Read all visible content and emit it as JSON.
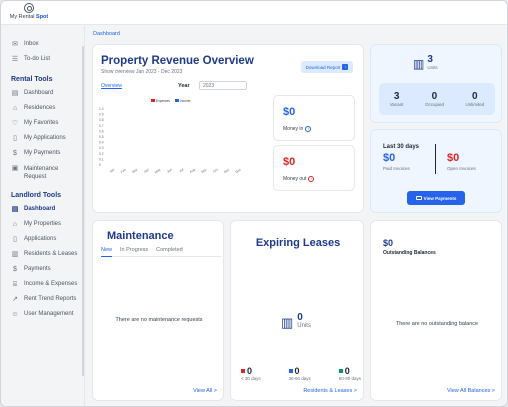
{
  "app": {
    "logo_prefix": "My Rental",
    "logo_brand": "Spot"
  },
  "breadcrumb": "Dashboard",
  "sidebar": {
    "top_items": [
      {
        "label": "Inbox"
      },
      {
        "label": "To-do List"
      }
    ],
    "rental_title": "Rental Tools",
    "rental_items": [
      {
        "label": "Dashboard"
      },
      {
        "label": "Residences"
      },
      {
        "label": "My Favorites"
      },
      {
        "label": "My Applications"
      },
      {
        "label": "My Payments"
      },
      {
        "label": "Maintenance Request"
      }
    ],
    "landlord_title": "Landlord Tools",
    "landlord_items": [
      {
        "label": "Dashboard"
      },
      {
        "label": "My Properties"
      },
      {
        "label": "Applications"
      },
      {
        "label": "Residents & Leases"
      },
      {
        "label": "Payments"
      },
      {
        "label": "Income & Expenses"
      },
      {
        "label": "Rent Trend Reports"
      },
      {
        "label": "User Management"
      }
    ]
  },
  "revenue": {
    "title": "Property Revenue Overview",
    "subtitle": "Show overview Jan 2023 - Dec 2023",
    "tab": "Overview",
    "year_label": "Year",
    "year_value": "2023",
    "download_label": "Download Report",
    "money_in_value": "$0",
    "money_in_label": "Money in",
    "money_out_value": "$0",
    "money_out_label": "Money out"
  },
  "chart_data": {
    "type": "bar",
    "categories": [
      "Jan",
      "Feb",
      "Mar",
      "Apr",
      "May",
      "Jun",
      "Jul",
      "Aug",
      "Sep",
      "Oct",
      "Nov",
      "Dec"
    ],
    "series": [
      {
        "name": "Expenses",
        "values": [
          0,
          0,
          0,
          0,
          0,
          0,
          0,
          0,
          0,
          0,
          0,
          0
        ]
      },
      {
        "name": "Income",
        "values": [
          0,
          0,
          0,
          0,
          0,
          0,
          0,
          0,
          0,
          0,
          0,
          0
        ]
      }
    ],
    "yticks": [
      "1.0",
      "0.9",
      "0.8",
      "0.7",
      "0.6",
      "0.5",
      "0.4",
      "0.3",
      "0.2",
      "0.1",
      "0"
    ],
    "ylim": [
      0,
      1
    ],
    "colors": {
      "Expenses": "#dc2626",
      "Income": "#2563eb"
    }
  },
  "units": {
    "count": "3",
    "label": "Units",
    "vacant_count": "3",
    "vacant_label": "Vacant",
    "occupied_count": "0",
    "occupied_label": "Occupied",
    "unlimited_count": "0",
    "unlimited_label": "Unlimited"
  },
  "invoices": {
    "period": "Last 30 days",
    "paid_value": "$0",
    "paid_label": "Paid Invoices",
    "open_value": "$0",
    "open_label": "Open Invoices",
    "button": "View Payments"
  },
  "maintenance": {
    "title": "Maintenance",
    "tabs": [
      {
        "label": "New"
      },
      {
        "label": "In Progress"
      },
      {
        "label": "Completed"
      }
    ],
    "empty": "There are no maintenance requests",
    "view_all": "View All >"
  },
  "leases": {
    "title": "Expiring Leases",
    "units_count": "0",
    "units_label": "Units",
    "buckets": [
      {
        "count": "0",
        "label": "< 30 days"
      },
      {
        "count": "0",
        "label": "30-60 days"
      },
      {
        "count": "0",
        "label": "60-90 days"
      }
    ],
    "link": "Residents & Leases >"
  },
  "balances": {
    "value": "$0",
    "title": "Outstanding Balances",
    "empty": "There are no outstanding balance",
    "link": "View All Balances >"
  },
  "colors": {
    "accent": "#1e3a8a",
    "link": "#2563eb",
    "danger": "#dc2626",
    "success": "#059669"
  }
}
